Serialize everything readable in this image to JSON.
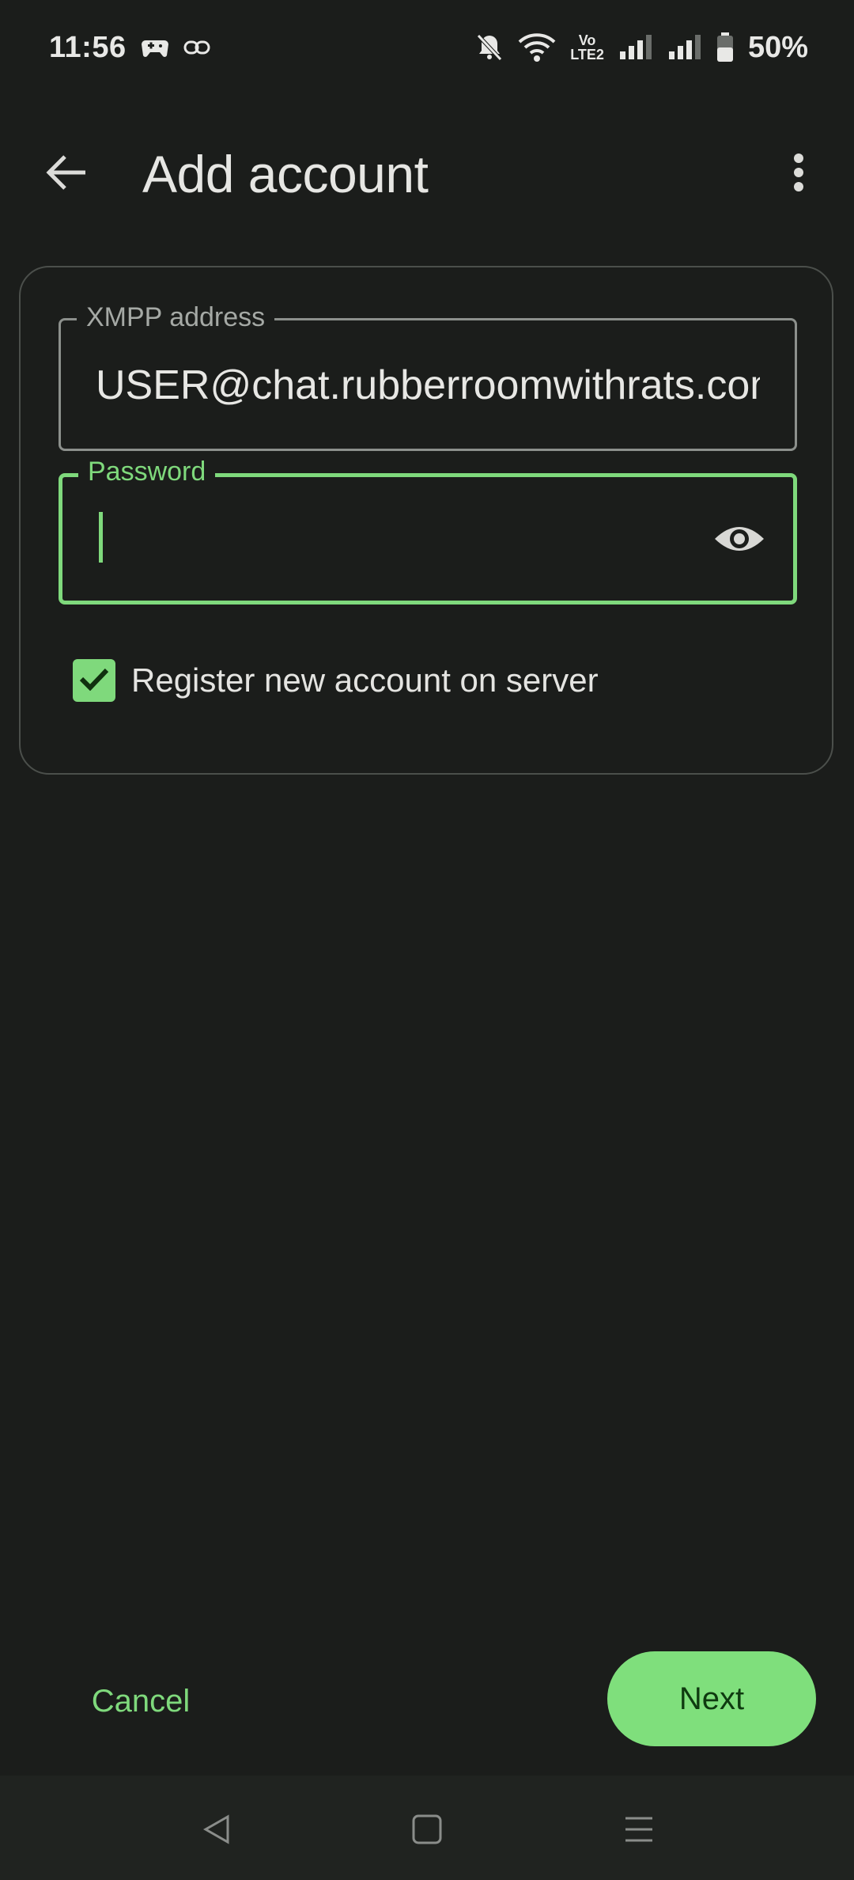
{
  "status_bar": {
    "time": "11:56",
    "battery_percent": "50%",
    "network_label_top": "Vo",
    "network_label_bottom": "LTE2",
    "icons": [
      "game-controller-icon",
      "link-icon",
      "bell-muted-icon",
      "wifi-icon",
      "volte-icon",
      "signal-icon",
      "signal-icon",
      "battery-icon"
    ]
  },
  "app_bar": {
    "title": "Add account",
    "back_icon": "arrow-back-icon",
    "menu_icon": "more-vert-icon"
  },
  "form": {
    "xmpp": {
      "label": "XMPP address",
      "value": "USER@chat.rubberroomwithrats.com"
    },
    "password": {
      "label": "Password",
      "value": "",
      "toggle_icon": "eye-icon"
    },
    "register": {
      "label": "Register new account on server",
      "checked": true
    }
  },
  "actions": {
    "cancel": "Cancel",
    "next": "Next"
  },
  "colors": {
    "background": "#1b1d1b",
    "accent": "#7fd97c",
    "on_accent": "#0f3a10",
    "outline": "#8c908c"
  }
}
